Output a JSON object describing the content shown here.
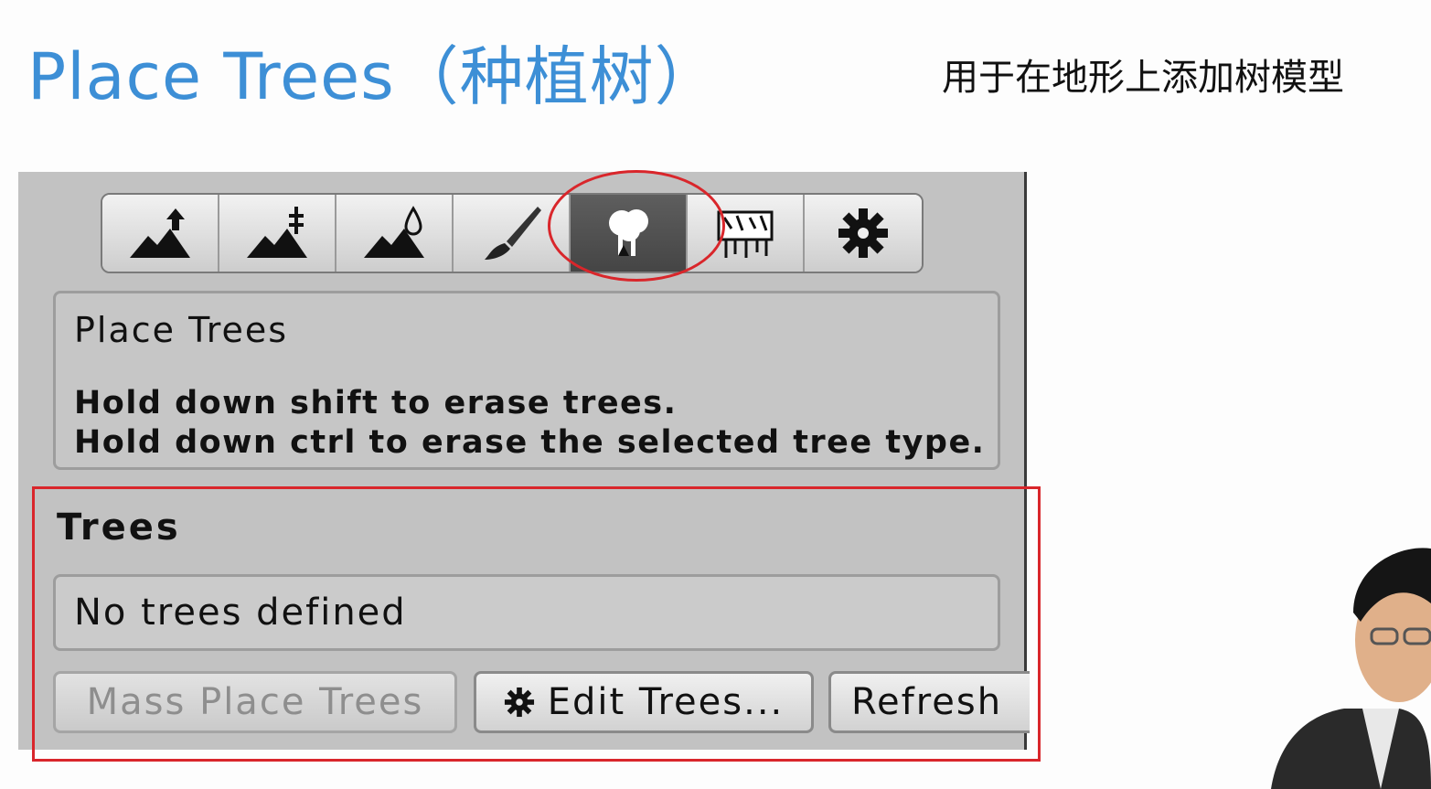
{
  "slide": {
    "title": "Place Trees（种植树）",
    "subtitle": "用于在地形上添加树模型"
  },
  "toolbar": {
    "tools": [
      {
        "icon": "raise-terrain-icon",
        "active": false
      },
      {
        "icon": "set-height-icon",
        "active": false
      },
      {
        "icon": "smooth-height-icon",
        "active": false
      },
      {
        "icon": "paint-texture-icon",
        "active": false
      },
      {
        "icon": "place-trees-icon",
        "active": true
      },
      {
        "icon": "paint-details-icon",
        "active": false
      },
      {
        "icon": "settings-gear-icon",
        "active": false
      }
    ]
  },
  "help": {
    "title": "Place Trees",
    "line1": "Hold down shift to erase trees.",
    "line2": "Hold down ctrl to erase the selected tree type."
  },
  "trees": {
    "header": "Trees",
    "empty_message": "No trees defined"
  },
  "buttons": {
    "mass_place": "Mass Place Trees",
    "edit_trees": "Edit Trees...",
    "refresh": "Refresh"
  },
  "colors": {
    "title_blue": "#3d8fd6",
    "annotation_red": "#d9262b",
    "panel_gray": "#c2c2c2"
  }
}
